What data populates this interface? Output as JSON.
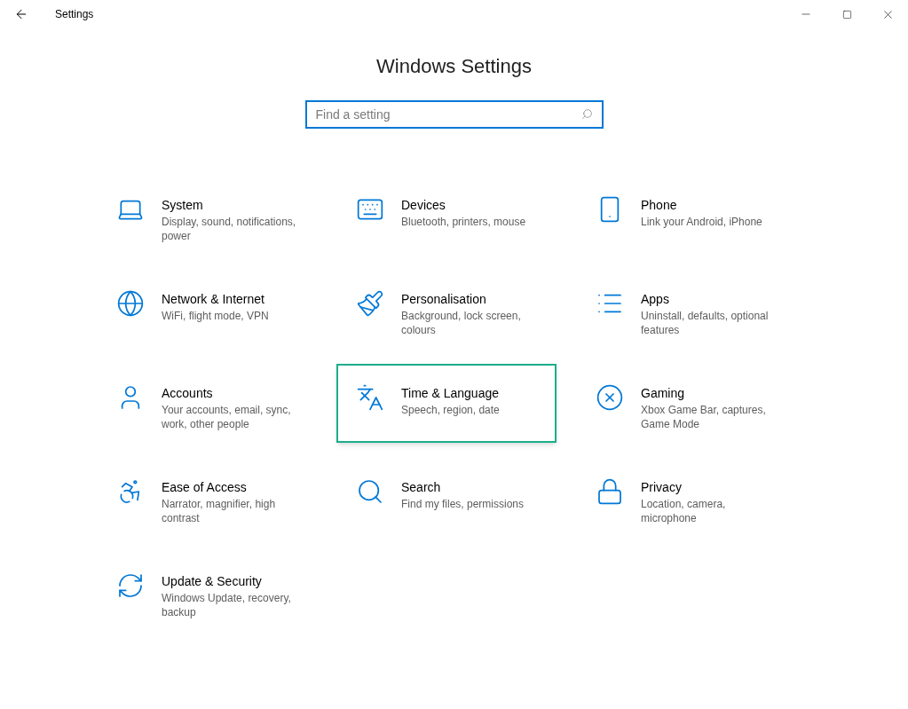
{
  "window": {
    "title": "Settings"
  },
  "heading": "Windows Settings",
  "search": {
    "placeholder": "Find a setting"
  },
  "categories": [
    {
      "kind": "laptop",
      "title": "System",
      "description": "Display, sound, notifications, power",
      "highlighted": false
    },
    {
      "kind": "devices",
      "title": "Devices",
      "description": "Bluetooth, printers, mouse",
      "highlighted": false
    },
    {
      "kind": "phone",
      "title": "Phone",
      "description": "Link your Android, iPhone",
      "highlighted": false
    },
    {
      "kind": "globe",
      "title": "Network & Internet",
      "description": "WiFi, flight mode, VPN",
      "highlighted": false
    },
    {
      "kind": "brush",
      "title": "Personalisation",
      "description": "Background, lock screen, colours",
      "highlighted": false
    },
    {
      "kind": "list",
      "title": "Apps",
      "description": "Uninstall, defaults, optional features",
      "highlighted": false
    },
    {
      "kind": "user",
      "title": "Accounts",
      "description": "Your accounts, email, sync, work, other people",
      "highlighted": false
    },
    {
      "kind": "language",
      "title": "Time & Language",
      "description": "Speech, region, date",
      "highlighted": true
    },
    {
      "kind": "xbox",
      "title": "Gaming",
      "description": "Xbox Game Bar, captures, Game Mode",
      "highlighted": false
    },
    {
      "kind": "access",
      "title": "Ease of Access",
      "description": "Narrator, magnifier, high contrast",
      "highlighted": false
    },
    {
      "kind": "search",
      "title": "Search",
      "description": "Find my files, permissions",
      "highlighted": false
    },
    {
      "kind": "lock",
      "title": "Privacy",
      "description": "Location, camera, microphone",
      "highlighted": false
    },
    {
      "kind": "update",
      "title": "Update & Security",
      "description": "Windows Update, recovery, backup",
      "highlighted": false
    }
  ]
}
